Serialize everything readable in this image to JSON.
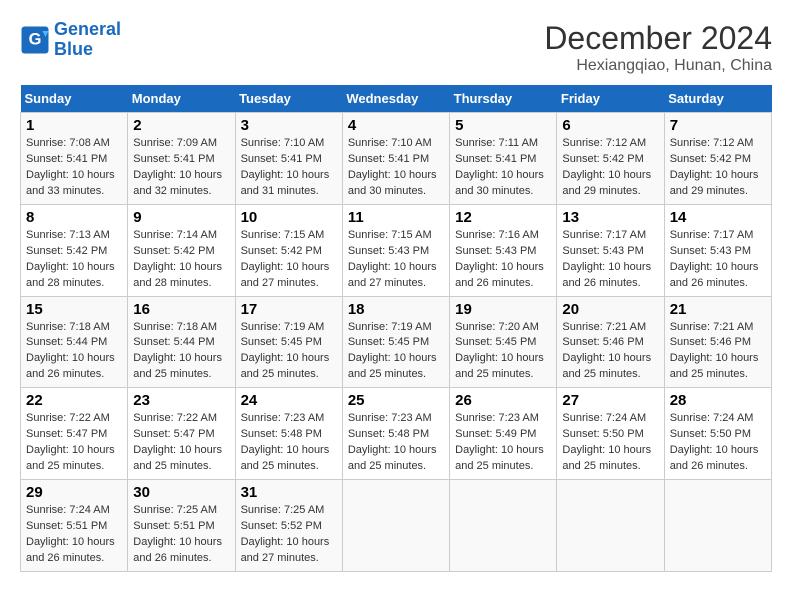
{
  "logo": {
    "line1": "General",
    "line2": "Blue"
  },
  "title": "December 2024",
  "location": "Hexiangqiao, Hunan, China",
  "days_of_week": [
    "Sunday",
    "Monday",
    "Tuesday",
    "Wednesday",
    "Thursday",
    "Friday",
    "Saturday"
  ],
  "weeks": [
    [
      {
        "day": "1",
        "sunrise": "7:08 AM",
        "sunset": "5:41 PM",
        "daylight": "10 hours and 33 minutes."
      },
      {
        "day": "2",
        "sunrise": "7:09 AM",
        "sunset": "5:41 PM",
        "daylight": "10 hours and 32 minutes."
      },
      {
        "day": "3",
        "sunrise": "7:10 AM",
        "sunset": "5:41 PM",
        "daylight": "10 hours and 31 minutes."
      },
      {
        "day": "4",
        "sunrise": "7:10 AM",
        "sunset": "5:41 PM",
        "daylight": "10 hours and 30 minutes."
      },
      {
        "day": "5",
        "sunrise": "7:11 AM",
        "sunset": "5:41 PM",
        "daylight": "10 hours and 30 minutes."
      },
      {
        "day": "6",
        "sunrise": "7:12 AM",
        "sunset": "5:42 PM",
        "daylight": "10 hours and 29 minutes."
      },
      {
        "day": "7",
        "sunrise": "7:12 AM",
        "sunset": "5:42 PM",
        "daylight": "10 hours and 29 minutes."
      }
    ],
    [
      {
        "day": "8",
        "sunrise": "7:13 AM",
        "sunset": "5:42 PM",
        "daylight": "10 hours and 28 minutes."
      },
      {
        "day": "9",
        "sunrise": "7:14 AM",
        "sunset": "5:42 PM",
        "daylight": "10 hours and 28 minutes."
      },
      {
        "day": "10",
        "sunrise": "7:15 AM",
        "sunset": "5:42 PM",
        "daylight": "10 hours and 27 minutes."
      },
      {
        "day": "11",
        "sunrise": "7:15 AM",
        "sunset": "5:43 PM",
        "daylight": "10 hours and 27 minutes."
      },
      {
        "day": "12",
        "sunrise": "7:16 AM",
        "sunset": "5:43 PM",
        "daylight": "10 hours and 26 minutes."
      },
      {
        "day": "13",
        "sunrise": "7:17 AM",
        "sunset": "5:43 PM",
        "daylight": "10 hours and 26 minutes."
      },
      {
        "day": "14",
        "sunrise": "7:17 AM",
        "sunset": "5:43 PM",
        "daylight": "10 hours and 26 minutes."
      }
    ],
    [
      {
        "day": "15",
        "sunrise": "7:18 AM",
        "sunset": "5:44 PM",
        "daylight": "10 hours and 26 minutes."
      },
      {
        "day": "16",
        "sunrise": "7:18 AM",
        "sunset": "5:44 PM",
        "daylight": "10 hours and 25 minutes."
      },
      {
        "day": "17",
        "sunrise": "7:19 AM",
        "sunset": "5:45 PM",
        "daylight": "10 hours and 25 minutes."
      },
      {
        "day": "18",
        "sunrise": "7:19 AM",
        "sunset": "5:45 PM",
        "daylight": "10 hours and 25 minutes."
      },
      {
        "day": "19",
        "sunrise": "7:20 AM",
        "sunset": "5:45 PM",
        "daylight": "10 hours and 25 minutes."
      },
      {
        "day": "20",
        "sunrise": "7:21 AM",
        "sunset": "5:46 PM",
        "daylight": "10 hours and 25 minutes."
      },
      {
        "day": "21",
        "sunrise": "7:21 AM",
        "sunset": "5:46 PM",
        "daylight": "10 hours and 25 minutes."
      }
    ],
    [
      {
        "day": "22",
        "sunrise": "7:22 AM",
        "sunset": "5:47 PM",
        "daylight": "10 hours and 25 minutes."
      },
      {
        "day": "23",
        "sunrise": "7:22 AM",
        "sunset": "5:47 PM",
        "daylight": "10 hours and 25 minutes."
      },
      {
        "day": "24",
        "sunrise": "7:23 AM",
        "sunset": "5:48 PM",
        "daylight": "10 hours and 25 minutes."
      },
      {
        "day": "25",
        "sunrise": "7:23 AM",
        "sunset": "5:48 PM",
        "daylight": "10 hours and 25 minutes."
      },
      {
        "day": "26",
        "sunrise": "7:23 AM",
        "sunset": "5:49 PM",
        "daylight": "10 hours and 25 minutes."
      },
      {
        "day": "27",
        "sunrise": "7:24 AM",
        "sunset": "5:50 PM",
        "daylight": "10 hours and 25 minutes."
      },
      {
        "day": "28",
        "sunrise": "7:24 AM",
        "sunset": "5:50 PM",
        "daylight": "10 hours and 26 minutes."
      }
    ],
    [
      {
        "day": "29",
        "sunrise": "7:24 AM",
        "sunset": "5:51 PM",
        "daylight": "10 hours and 26 minutes."
      },
      {
        "day": "30",
        "sunrise": "7:25 AM",
        "sunset": "5:51 PM",
        "daylight": "10 hours and 26 minutes."
      },
      {
        "day": "31",
        "sunrise": "7:25 AM",
        "sunset": "5:52 PM",
        "daylight": "10 hours and 27 minutes."
      },
      null,
      null,
      null,
      null
    ]
  ],
  "labels": {
    "sunrise": "Sunrise:",
    "sunset": "Sunset:",
    "daylight": "Daylight:"
  }
}
